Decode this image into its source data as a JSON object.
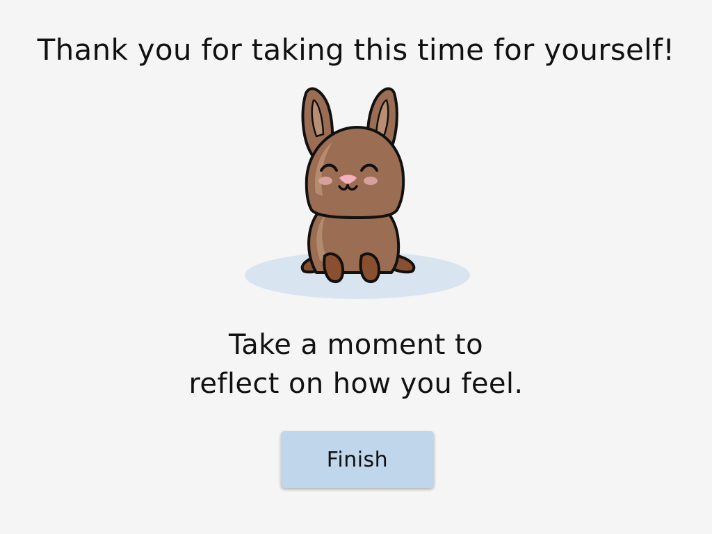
{
  "completion": {
    "title": "Thank you for taking this time for yourself!",
    "message_line1": "Take a moment to",
    "message_line2": "reflect on how you feel.",
    "finish_label": "Finish"
  },
  "illustration": {
    "icon": "bunny-illustration",
    "colors": {
      "fur": "#9b6d52",
      "fur_highlight": "#b98f74",
      "feet": "#8a4f2f",
      "cheeks": "#d7a09c",
      "nose": "#f4b1bd",
      "shadow": "#d8e5f0",
      "outline": "#111111"
    }
  },
  "colors": {
    "background": "#f4f5f4",
    "button": "#bfd6eb",
    "text": "#111111"
  }
}
